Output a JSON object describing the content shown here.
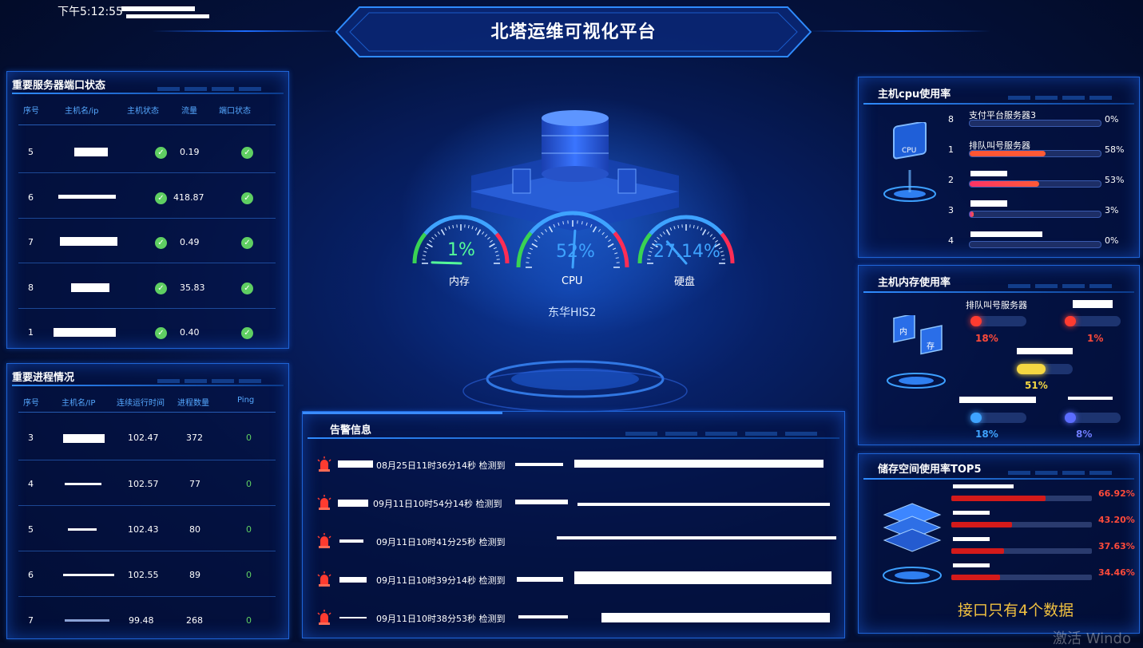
{
  "header": {
    "time": "下午5:12:55",
    "title": "北塔运维可视化平台"
  },
  "ports_panel": {
    "title": "重要服务器端口状态",
    "columns": [
      "序号",
      "主机名/ip",
      "主机状态",
      "流量",
      "端口状态"
    ],
    "rows": [
      {
        "index": "5",
        "traffic": "0.19"
      },
      {
        "index": "6",
        "traffic": "418.87"
      },
      {
        "index": "7",
        "traffic": "0.49"
      },
      {
        "index": "8",
        "traffic": "35.83"
      },
      {
        "index": "1",
        "traffic": "0.40"
      }
    ],
    "status_icon": "check-circle-icon"
  },
  "process_panel": {
    "title": "重要进程情况",
    "columns": [
      "序号",
      "主机名/IP",
      "连续运行时间",
      "进程数量",
      "Ping"
    ],
    "rows": [
      {
        "index": "3",
        "runtime": "102.47",
        "count": "372",
        "ping": "0"
      },
      {
        "index": "4",
        "runtime": "102.57",
        "count": "77",
        "ping": "0"
      },
      {
        "index": "5",
        "runtime": "102.43",
        "count": "80",
        "ping": "0"
      },
      {
        "index": "6",
        "runtime": "102.55",
        "count": "89",
        "ping": "0"
      },
      {
        "index": "7",
        "runtime": "99.48",
        "count": "268",
        "ping": "0"
      }
    ]
  },
  "center": {
    "host": "东华HIS2",
    "gauges": [
      {
        "value": "1%",
        "label": "内存",
        "level": 0.01,
        "color": "#55ff99"
      },
      {
        "value": "52%",
        "label": "CPU",
        "level": 0.52,
        "color": "#3ea3ff"
      },
      {
        "value": "27.14%",
        "label": "硬盘",
        "level": 0.2714,
        "color": "#3ea3ff"
      }
    ]
  },
  "alarm_panel": {
    "title": "告警信息",
    "icon": "alarm-light-icon",
    "items": [
      {
        "time": "08月25日11时36分14秒 检测到"
      },
      {
        "time": "09月11日10时54分14秒 检测到"
      },
      {
        "time": "09月11日10时41分25秒 检测到"
      },
      {
        "time": "09月11日10时39分14秒 检测到"
      },
      {
        "time": "09月11日10时38分53秒 检测到"
      }
    ]
  },
  "cpu_panel": {
    "title": "主机cpu使用率",
    "rows": [
      {
        "rank": "8",
        "name": "支付平台服务器3",
        "pct": "0%",
        "level": 0.0
      },
      {
        "rank": "1",
        "name": "排队叫号服务器",
        "pct": "58%",
        "level": 0.58
      },
      {
        "rank": "2",
        "name": "",
        "pct": "53%",
        "level": 0.53
      },
      {
        "rank": "3",
        "name": "",
        "pct": "3%",
        "level": 0.03
      },
      {
        "rank": "4",
        "name": "",
        "pct": "0%",
        "level": 0.0
      }
    ]
  },
  "mem_panel": {
    "title": "主机内存使用率",
    "items": [
      {
        "name": "排队叫号服务器",
        "pct": "18%",
        "level": 0.18,
        "color": "#ff3b30"
      },
      {
        "name": "",
        "pct": "1%",
        "level": 0.01,
        "color": "#ff3b30"
      },
      {
        "name": "",
        "pct": "51%",
        "level": 0.51,
        "color": "#f5d742"
      },
      {
        "name": "",
        "pct": "18%",
        "level": 0.18,
        "color": "#3ea3ff"
      },
      {
        "name": "",
        "pct": "8%",
        "level": 0.08,
        "color": "#5b6cff"
      }
    ]
  },
  "storage_panel": {
    "title": "储存空间使用率TOP5",
    "rows": [
      {
        "pct": "66.92%",
        "level": 0.6692
      },
      {
        "pct": "43.20%",
        "level": 0.432
      },
      {
        "pct": "37.63%",
        "level": 0.3763
      },
      {
        "pct": "34.46%",
        "level": 0.3446
      }
    ],
    "note": "接口只有4个数据"
  },
  "watermark": "激活 Windo"
}
